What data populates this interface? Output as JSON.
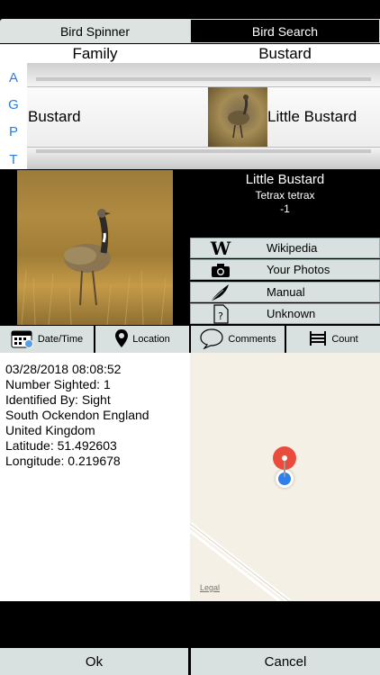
{
  "tabs": [
    {
      "label": "Bird Spinner"
    },
    {
      "label": "Bird Search"
    }
  ],
  "picker": {
    "column_headers": [
      "Family",
      "Bustard"
    ],
    "index_letters": [
      "A",
      "G",
      "P",
      "T"
    ],
    "selected_family": "Bustard",
    "selected_bird": "Little Bustard"
  },
  "bird": {
    "common_name": "Little Bustard",
    "scientific_name": "Tetrax tetrax",
    "number": "-1"
  },
  "links": [
    {
      "label": "Wikipedia",
      "icon": "wikipedia-icon"
    },
    {
      "label": "Your Photos",
      "icon": "camera-icon"
    },
    {
      "label": "Manual",
      "icon": "feather-icon"
    },
    {
      "label": "Unknown",
      "icon": "question-document-icon"
    }
  ],
  "info_tabs": [
    {
      "label": "Date/Time",
      "icon": "calendar-icon"
    },
    {
      "label": "Location",
      "icon": "location-pin-icon"
    },
    {
      "label": "Comments",
      "icon": "speech-bubble-icon"
    },
    {
      "label": "Count",
      "icon": "count-icon"
    }
  ],
  "details": {
    "lines": [
      "03/28/2018 08:08:52",
      "Number Sighted: 1",
      "Identified By: Sight",
      "South Ockendon England",
      "United Kingdom",
      "Latitude: 51.492603",
      "Longitude: 0.219678"
    ]
  },
  "map": {
    "legal_label": "Legal",
    "pin_color": "#e94b3c",
    "user_dot_color": "#2f80ed"
  },
  "buttons": {
    "ok_label": "Ok",
    "cancel_label": "Cancel"
  }
}
